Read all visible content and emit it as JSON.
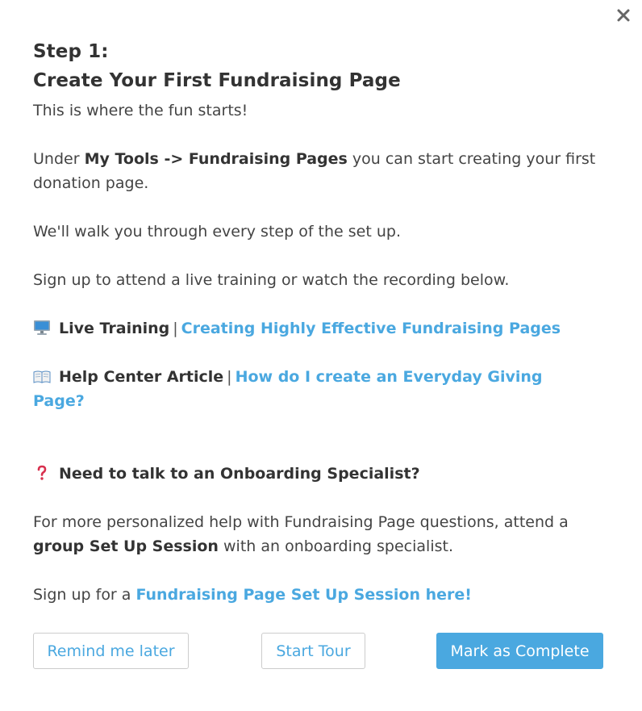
{
  "modal": {
    "title_line1": "Step 1:",
    "title_line2": "Create Your First Fundraising Page",
    "intro": "This is where the fun starts!",
    "under_prefix": "Under ",
    "under_bold": "My Tools -> Fundraising Pages",
    "under_suffix": " you can start creating your first donation page.",
    "walk": "We'll walk you through every step of the set up.",
    "signup_training": "Sign up to attend a live training or watch the recording below.",
    "live_training": {
      "icon": "computer-icon",
      "label": "Live Training",
      "separator": "|",
      "link": "Creating Highly Effective Fundraising Pages"
    },
    "help_article": {
      "icon": "open-book-icon",
      "label": "Help Center Article",
      "separator": "|",
      "link": "How do I create an Everyday Giving Page?"
    },
    "specialist": {
      "icon": "question-mark-icon",
      "heading": "Need to talk to an Onboarding Specialist?"
    },
    "personalized_prefix": "For more personalized help with Fundraising Page questions, attend a ",
    "personalized_bold": "group Set Up Session",
    "personalized_suffix": " with an onboarding specialist.",
    "session_prefix": "Sign up for a ",
    "session_link": "Fundraising Page Set Up Session here!"
  },
  "footer": {
    "remind_label": "Remind me later",
    "tour_label": "Start Tour",
    "complete_label": "Mark as Complete"
  },
  "colors": {
    "accent": "#4aa8e0",
    "text": "#444444"
  }
}
